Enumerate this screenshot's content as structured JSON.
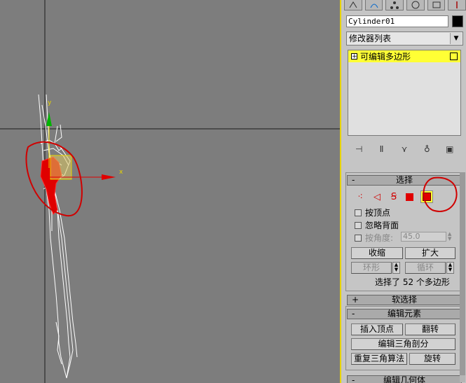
{
  "object": {
    "name": "Cylinder01"
  },
  "modifier_list": {
    "label": "修改器列表"
  },
  "stack": {
    "item": "可编辑多边形",
    "expand": "+"
  },
  "viewport": {
    "axis_x": "x",
    "axis_y": "y"
  },
  "selection": {
    "title": "选择",
    "sign": "-",
    "by_vertex": "按顶点",
    "ignore_backfacing": "忽略背面",
    "by_angle": "按角度:",
    "angle_value": "45.0",
    "shrink": "收缩",
    "grow": "扩大",
    "ring": "环形",
    "loop": "循环",
    "status": "选择了 52 个多边形"
  },
  "soft_selection": {
    "title": "软选择",
    "sign": "+"
  },
  "edit_elements": {
    "title": "编辑元素",
    "sign": "-",
    "insert_vertex": "插入顶点",
    "flip": "翻转",
    "edit_triangulation": "编辑三角剖分",
    "retriangulate": "重复三角算法",
    "turn": "旋转"
  },
  "edit_geometry": {
    "title": "编辑几何体",
    "sign": "-"
  },
  "colors": {
    "selected_face": "#e00000",
    "highlight": "#ffff35",
    "annotation": "#d00000"
  }
}
